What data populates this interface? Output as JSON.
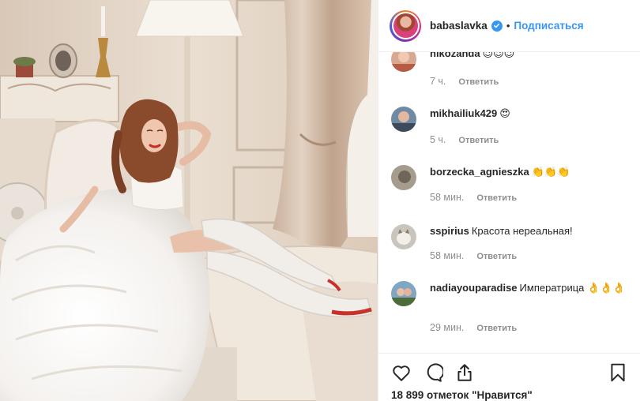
{
  "header": {
    "username": "babaslavka",
    "separator": "•",
    "follow_label": "Подписаться"
  },
  "comments": [
    {
      "username": "nikozanda",
      "text": "😉😉😉",
      "time": "7 ч.",
      "reply": "Ответить"
    },
    {
      "username": "mikhailiuk429",
      "text": "😍",
      "time": "5 ч.",
      "reply": "Ответить"
    },
    {
      "username": "borzecka_agnieszka",
      "text": "👏👏👏",
      "time": "58 мин.",
      "reply": "Ответить"
    },
    {
      "username": "sspirius",
      "text": "Красота нереальная!",
      "time": "58 мин.",
      "reply": "Ответить"
    },
    {
      "username": "nadiayouparadise",
      "text": "Императрица 👌👌👌",
      "time": "29 мин.",
      "reply": "Ответить"
    }
  ],
  "actions": {
    "icons": [
      "heart-icon",
      "comment-icon",
      "share-icon",
      "bookmark-icon"
    ]
  },
  "likes_text": "18 899 отметок \"Нравится\"",
  "colors": {
    "accent": "#3897f0",
    "text": "#262626",
    "muted": "#8e8e8e",
    "divider": "#efefef"
  }
}
